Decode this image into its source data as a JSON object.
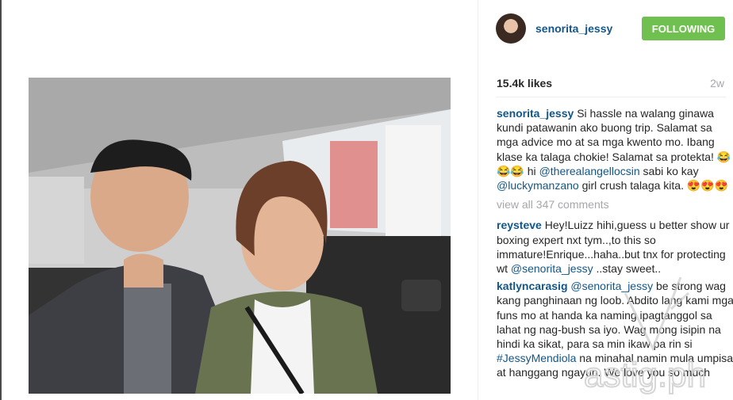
{
  "post": {
    "username": "senorita_jessy",
    "follow_label": "FOLLOWING",
    "likes": "15.4k likes",
    "time": "2w",
    "caption": {
      "user": "senorita_jessy",
      "text1": "Si hassle na walang ginawa kundi patawanin ako buong trip. Salamat sa mga advice mo at sa mga kwento mo. Ibang klase ka talaga chokie! Salamat sa protekta! ",
      "emoji1": "😂😂😂",
      "text2": " hi ",
      "mention1": "@therealangellocsin",
      "text3": " sabi ko kay ",
      "mention2": "@luckymanzano",
      "text4": " girl crush talaga kita. ",
      "emoji2": "😍😍😍"
    },
    "view_all": "view all 347 comments",
    "comments": [
      {
        "user": "reysteve",
        "text1": " Hey!Luizz hihi,guess u better show ur boxing expert nxt tym..,to this so immature!Enrique...haha..but tnx for protecting wt ",
        "mention": "@senorita_jessy",
        "text2": " ..stay sweet.."
      },
      {
        "user": "katlyncarasig",
        "text1": " ",
        "mention": "@senorita_jessy",
        "text2": " be strong wag kang panghinaan ng loob. Abdito lang kami mga funs mo at handa ka naming ipagtanggol sa lahat ng nag-bush sa iyo. Wag mong isipin na hindi ka sikat, para sa min ikaw pa rin si ",
        "mention2": "#JessyMendiola",
        "text3": " na minahal namin mula umpisa at hanggang ngayun. We love you so much"
      }
    ]
  },
  "watermark": "astig.ph",
  "icons": {
    "avatar": "profile-avatar"
  }
}
